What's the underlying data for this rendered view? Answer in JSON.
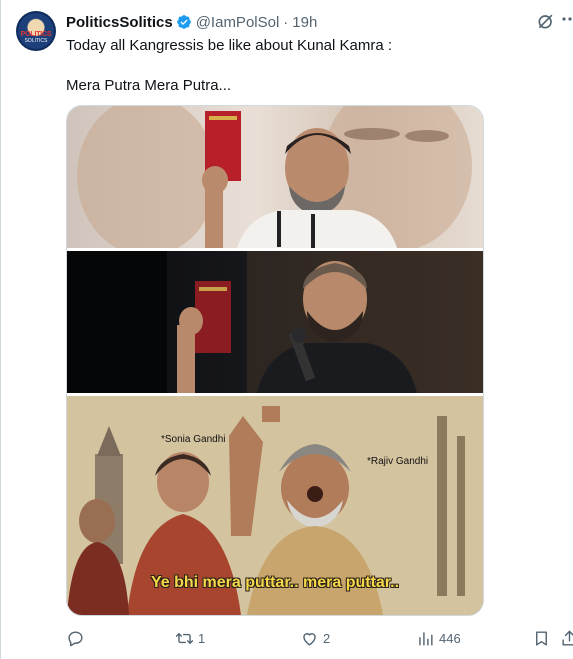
{
  "post": {
    "display_name": "PoliticsSolitics",
    "handle": "@IamPolSol",
    "separator": "·",
    "time_ago": "19h",
    "text_line1": "Today all Kangressis be like about Kunal Kamra :",
    "text_line2": "Mera Putra Mera Putra...",
    "avatar_text_top": "POLITICS",
    "avatar_text_bottom": "SOLITICS"
  },
  "media": {
    "panel3_label_left": "*Sonia Gandhi",
    "panel3_label_right": "*Rajiv Gandhi",
    "panel3_caption": "Ye bhi mera puttar.. mera puttar.."
  },
  "actions": {
    "reply_count": "",
    "repost_count": "1",
    "like_count": "2",
    "views_count": "446"
  },
  "colors": {
    "text_primary": "#0f1419",
    "text_secondary": "#536471",
    "verified_blue": "#1d9bf0",
    "border": "#cfd9de",
    "caption_yellow": "#f6d84a"
  },
  "icons": {
    "verified": "verified-badge-icon",
    "grok": "grok-icon",
    "more": "more-icon",
    "reply": "reply-icon",
    "repost": "repost-icon",
    "like": "like-icon",
    "views": "views-icon",
    "bookmark": "bookmark-icon"
  }
}
